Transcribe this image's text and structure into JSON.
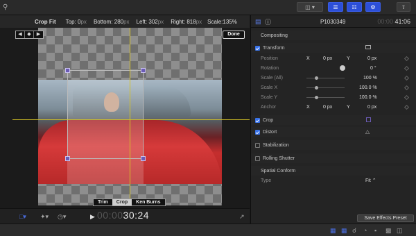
{
  "topbar": {
    "icons": [
      "layout-icon",
      "timeline-icon",
      "inspector-toggle-icon",
      "browser-toggle-icon",
      "adjust-icon",
      "share-icon"
    ]
  },
  "crop_bar": {
    "label": "Crop Fit",
    "top_label": "Top:",
    "top_value": "0",
    "bottom_label": "Bottom:",
    "bottom_value": "280",
    "left_label": "Left:",
    "left_value": "302",
    "right_label": "Right:",
    "right_value": "818",
    "unit": "px",
    "scale_label": "Scale:",
    "scale_value": "135%"
  },
  "viewer": {
    "done_label": "Done",
    "modes": [
      "Trim",
      "Crop",
      "Ken Burns"
    ],
    "selected_mode": "Crop",
    "timecode_dim": "00:00",
    "timecode": "30:24"
  },
  "inspector": {
    "clip_name": "P1030349",
    "duration_dim": "00:00",
    "duration": "41:06",
    "section_compositing": "Compositing",
    "transform": {
      "label": "Transform",
      "position_label": "Position",
      "position_x_label": "X",
      "position_x": "0",
      "position_y_label": "Y",
      "position_y": "0",
      "unit_px": "px",
      "rotation_label": "Rotation",
      "rotation_value": "0 °",
      "scale_all_label": "Scale (All)",
      "scale_all_value": "100 %",
      "scale_x_label": "Scale X",
      "scale_x_value": "100.0 %",
      "scale_y_label": "Scale Y",
      "scale_y_value": "100.0 %",
      "anchor_label": "Anchor",
      "anchor_x_label": "X",
      "anchor_x": "0",
      "anchor_y_label": "Y",
      "anchor_y": "0"
    },
    "crop_label": "Crop",
    "distort_label": "Distort",
    "stabilization_label": "Stabilization",
    "rolling_shutter_label": "Rolling Shutter",
    "spatial_conform_label": "Spatial Conform",
    "type_label": "Type",
    "type_value": "Fit ⌃",
    "save_preset_label": "Save Effects Preset"
  },
  "colors": {
    "accent": "#2c4fd8",
    "guide": "#d4c226",
    "checkbox": "#3872e8"
  }
}
